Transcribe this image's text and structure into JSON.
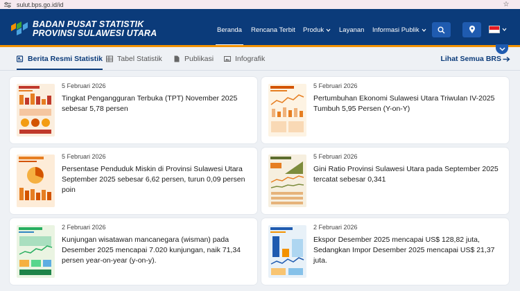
{
  "browser": {
    "url": "sulut.bps.go.id/id"
  },
  "header": {
    "brand_line1": "BADAN PUSAT STATISTIK",
    "brand_line2": "PROVINSI SULAWESI UTARA",
    "nav": [
      {
        "label": "Beranda"
      },
      {
        "label": "Rencana Terbit"
      },
      {
        "label": "Produk"
      },
      {
        "label": "Layanan"
      },
      {
        "label": "Informasi Publik"
      }
    ]
  },
  "tabs": [
    {
      "label": "Berita Resmi Statistik"
    },
    {
      "label": "Tabel Statistik"
    },
    {
      "label": "Publikasi"
    },
    {
      "label": "Infografik"
    }
  ],
  "see_all": "Lihat Semua BRS",
  "cards": [
    {
      "date": "5 Februari 2026",
      "title": "Tingkat Pengangguran Terbuka (TPT) November 2025 sebesar 5,78 persen"
    },
    {
      "date": "5 Februari 2026",
      "title": "Pertumbuhan Ekonomi Sulawesi Utara Triwulan IV-2025 Tumbuh 5,95 Persen (Y-on-Y)"
    },
    {
      "date": "5 Februari 2026",
      "title": "Persentase Penduduk Miskin di Provinsi Sulawesi Utara September 2025 sebesar 6,62 persen, turun 0,09 persen poin"
    },
    {
      "date": "5 Februari 2026",
      "title": "Gini Ratio Provinsi Sulawesi Utara pada September 2025 tercatat sebesar 0,341"
    },
    {
      "date": "2 Februari 2026",
      "title": "Kunjungan wisatawan mancanegara (wisman) pada Desember 2025 mencapai 7.020 kunjungan, naik 71,34 persen year-on-year (y-on-y)."
    },
    {
      "date": "2 Februari 2026",
      "title": "Ekspor Desember 2025 mencapai US$ 128,82 juta, Sedangkan Impor Desember 2025 mencapai US$ 21,37 juta."
    }
  ],
  "colors": {
    "header_bg": "#0b3b7a",
    "accent": "#f39200",
    "button_bg": "#1f5bb0"
  }
}
